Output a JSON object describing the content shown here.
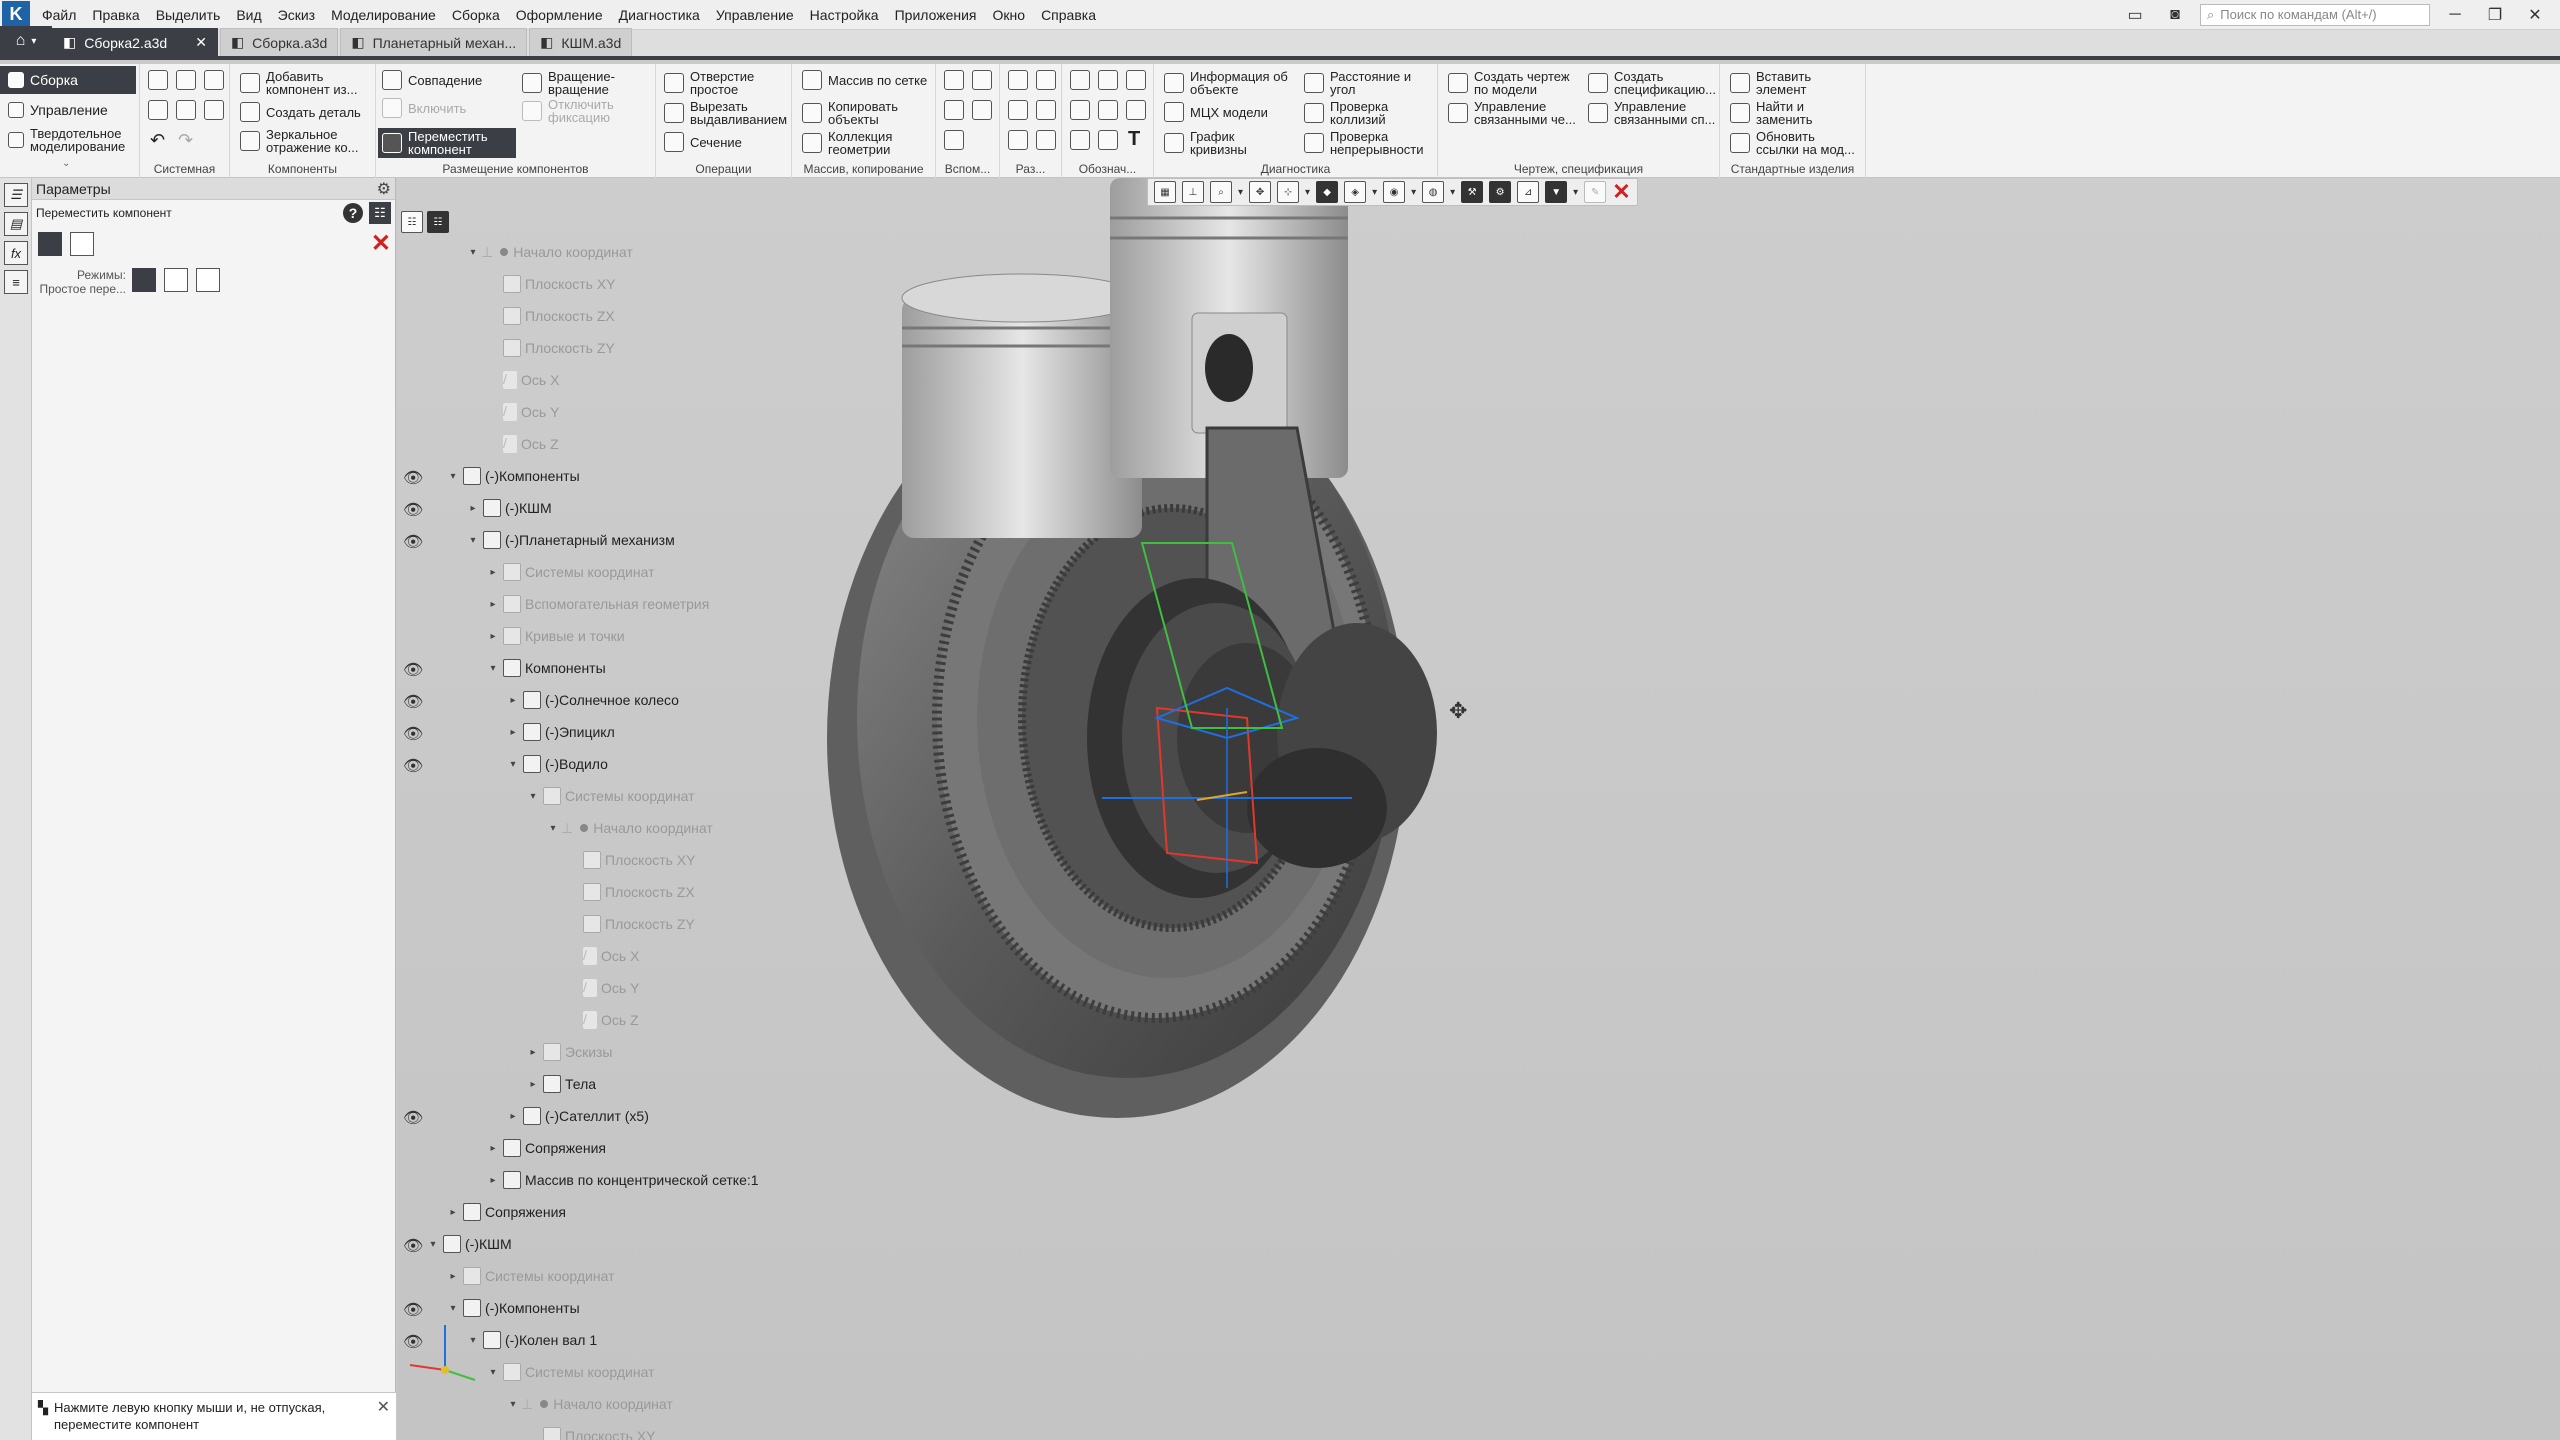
{
  "menubar": {
    "items": [
      "Файл",
      "Правка",
      "Выделить",
      "Вид",
      "Эскиз",
      "Моделирование",
      "Сборка",
      "Оформление",
      "Диагностика",
      "Управление",
      "Настройка",
      "Приложения",
      "Окно",
      "Справка"
    ],
    "search_placeholder": "Поиск по командам (Alt+/)"
  },
  "tabs": [
    {
      "label": "Сборка2.a3d",
      "active": true
    },
    {
      "label": "Сборка.a3d",
      "active": false
    },
    {
      "label": "Планетарный механ...",
      "active": false
    },
    {
      "label": "КШМ.a3d",
      "active": false
    }
  ],
  "ribbon": {
    "modes": [
      "Сборка",
      "Управление",
      "Твердотельное моделирование"
    ],
    "groups": {
      "system": "Системная",
      "components": "Компоненты",
      "placement": "Размещение компонентов",
      "operations": "Операции",
      "array": "Массив, копирование",
      "aux": "Вспом...",
      "size": "Раз...",
      "notation": "Обознач...",
      "diagnostics": "Диагностика",
      "drawing": "Чертеж, спецификация",
      "standard": "Стандартные изделия"
    },
    "buttons": {
      "add_component": "Добавить компонент из...",
      "create_part": "Создать деталь",
      "mirror": "Зеркальное отражение ко...",
      "coincidence": "Совпадение",
      "rotation": "Вращение-вращение",
      "enable": "Включить",
      "disable_fix": "Отключить фиксацию",
      "move_component": "Переместить компонент",
      "hole": "Отверстие простое",
      "cut_extrude": "Вырезать выдавливанием",
      "section": "Сечение",
      "grid_array": "Массив по сетке",
      "copy_objects": "Копировать объекты",
      "geom_collection": "Коллекция геометрии",
      "object_info": "Информация об объекте",
      "mcs": "МЦХ модели",
      "curvature": "График кривизны",
      "distance": "Расстояние и угол",
      "collision": "Проверка коллизий",
      "continuity": "Проверка непрерывности",
      "create_drawing": "Создать чертеж по модели",
      "manage_linked": "Управление связанными че...",
      "create_spec": "Создать спецификацию...",
      "manage_linked_sp": "Управление связанными сп...",
      "insert_element": "Вставить элемент",
      "find_replace": "Найти и заменить",
      "update_links": "Обновить ссылки на мод..."
    }
  },
  "params": {
    "title": "Параметры",
    "command": "Переместить компонент",
    "mode_label": "Режимы:",
    "mode_value": "Простое пере...",
    "hint": "Нажмите левую кнопку мыши и, не отпуская, переместите компонент"
  },
  "tree": [
    {
      "label": "Начало координат",
      "indent": 0,
      "arrow": "▾",
      "icon": "origin",
      "dim": true,
      "eye": false
    },
    {
      "label": "Плоскость XY",
      "indent": 1,
      "arrow": "",
      "icon": "plane",
      "dim": true,
      "eye": false
    },
    {
      "label": "Плоскость ZX",
      "indent": 1,
      "arrow": "",
      "icon": "planez",
      "dim": true,
      "eye": false
    },
    {
      "label": "Плоскость ZY",
      "indent": 1,
      "arrow": "",
      "icon": "planey",
      "dim": true,
      "eye": false
    },
    {
      "label": "Ось X",
      "indent": 1,
      "arrow": "",
      "icon": "axis",
      "dim": true,
      "eye": false
    },
    {
      "label": "Ось Y",
      "indent": 1,
      "arrow": "",
      "icon": "axis",
      "dim": true,
      "eye": false
    },
    {
      "label": "Ось Z",
      "indent": 1,
      "arrow": "",
      "icon": "axis",
      "dim": true,
      "eye": false
    },
    {
      "label": "(-)Компоненты",
      "indent": -1,
      "arrow": "▾",
      "icon": "comp",
      "dim": false,
      "eye": true
    },
    {
      "label": "(-)КШМ",
      "indent": 0,
      "arrow": "▸",
      "icon": "asm",
      "dim": false,
      "eye": true
    },
    {
      "label": "(-)Планетарный механизм",
      "indent": 0,
      "arrow": "▾",
      "icon": "asm",
      "dim": false,
      "eye": true
    },
    {
      "label": "Системы координат",
      "indent": 1,
      "arrow": "▸",
      "icon": "cs",
      "dim": true,
      "eye": false
    },
    {
      "label": "Вспомогательная геометрия",
      "indent": 1,
      "arrow": "▸",
      "icon": "cs",
      "dim": true,
      "eye": false
    },
    {
      "label": "Кривые и точки",
      "indent": 1,
      "arrow": "▸",
      "icon": "cs",
      "dim": true,
      "eye": false
    },
    {
      "label": "Компоненты",
      "indent": 1,
      "arrow": "▾",
      "icon": "comp",
      "dim": false,
      "eye": true
    },
    {
      "label": "(-)Солнечное колесо",
      "indent": 2,
      "arrow": "▸",
      "icon": "part",
      "dim": false,
      "eye": true
    },
    {
      "label": "(-)Эпицикл",
      "indent": 2,
      "arrow": "▸",
      "icon": "part",
      "dim": false,
      "eye": true
    },
    {
      "label": "(-)Водило",
      "indent": 2,
      "arrow": "▾",
      "icon": "part",
      "dim": false,
      "eye": true
    },
    {
      "label": "Системы координат",
      "indent": 3,
      "arrow": "▾",
      "icon": "cs",
      "dim": true,
      "eye": false
    },
    {
      "label": "Начало координат",
      "indent": 4,
      "arrow": "▾",
      "icon": "origin",
      "dim": true,
      "eye": false
    },
    {
      "label": "Плоскость XY",
      "indent": 5,
      "arrow": "",
      "icon": "plane",
      "dim": true,
      "eye": false
    },
    {
      "label": "Плоскость ZX",
      "indent": 5,
      "arrow": "",
      "icon": "planez",
      "dim": true,
      "eye": false
    },
    {
      "label": "Плоскость ZY",
      "indent": 5,
      "arrow": "",
      "icon": "planey",
      "dim": true,
      "eye": false
    },
    {
      "label": "Ось X",
      "indent": 5,
      "arrow": "",
      "icon": "axis",
      "dim": true,
      "eye": false
    },
    {
      "label": "Ось Y",
      "indent": 5,
      "arrow": "",
      "icon": "axis",
      "dim": true,
      "eye": false
    },
    {
      "label": "Ось Z",
      "indent": 5,
      "arrow": "",
      "icon": "axis",
      "dim": true,
      "eye": false
    },
    {
      "label": "Эскизы",
      "indent": 3,
      "arrow": "▸",
      "icon": "cs",
      "dim": true,
      "eye": false
    },
    {
      "label": "Тела",
      "indent": 3,
      "arrow": "▸",
      "icon": "part",
      "dim": false,
      "eye": false
    },
    {
      "label": "(-)Сателлит (x5)",
      "indent": 2,
      "arrow": "▸",
      "icon": "part",
      "dim": false,
      "eye": true
    },
    {
      "label": "Сопряжения",
      "indent": 1,
      "arrow": "▸",
      "icon": "mate",
      "dim": false,
      "eye": false
    },
    {
      "label": "Массив по концентрической сетке:1",
      "indent": 1,
      "arrow": "▸",
      "icon": "arr",
      "dim": false,
      "eye": false
    },
    {
      "label": "Сопряжения",
      "indent": -1,
      "arrow": "▸",
      "icon": "mate",
      "dim": false,
      "eye": false
    },
    {
      "label": "(-)КШМ",
      "indent": -2,
      "arrow": "▾",
      "icon": "asm",
      "dim": false,
      "eye": true
    },
    {
      "label": "Системы координат",
      "indent": -1,
      "arrow": "▸",
      "icon": "cs",
      "dim": true,
      "eye": false
    },
    {
      "label": "(-)Компоненты",
      "indent": -1,
      "arrow": "▾",
      "icon": "comp",
      "dim": false,
      "eye": true
    },
    {
      "label": "(-)Колен вал 1",
      "indent": 0,
      "arrow": "▾",
      "icon": "part",
      "dim": false,
      "eye": true
    },
    {
      "label": "Системы координат",
      "indent": 1,
      "arrow": "▾",
      "icon": "cs",
      "dim": true,
      "eye": false
    },
    {
      "label": "Начало координат",
      "indent": 2,
      "arrow": "▾",
      "icon": "origin",
      "dim": true,
      "eye": false
    },
    {
      "label": "Плоскость XY",
      "indent": 3,
      "arrow": "",
      "icon": "plane",
      "dim": true,
      "eye": false
    }
  ],
  "colors": {
    "accent_dark": "#3b3f45",
    "close_red": "#d21f1f",
    "bbox_green": "#3fbf3f",
    "bbox_red": "#e0392b",
    "bbox_blue": "#1e6fe0"
  }
}
